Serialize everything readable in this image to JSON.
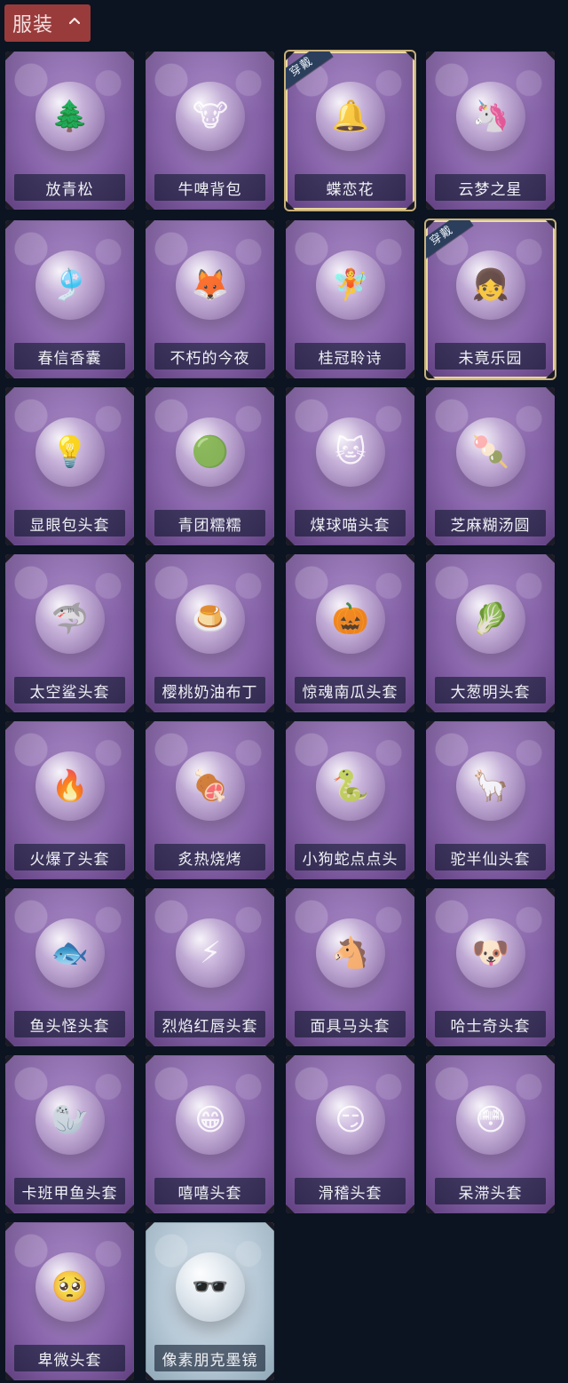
{
  "header": {
    "title": "服装",
    "chevron_icon": "chevron-up-icon"
  },
  "badges": {
    "wearing": "穿戴"
  },
  "items": [
    {
      "label": "放青松",
      "icon": "tree-icon",
      "selected": false,
      "theme": "purple"
    },
    {
      "label": "牛啤背包",
      "icon": "barrel-cow-icon",
      "selected": false,
      "theme": "purple"
    },
    {
      "label": "蝶恋花",
      "icon": "bell-ring-icon",
      "selected": true,
      "theme": "purple"
    },
    {
      "label": "云梦之星",
      "icon": "unicorn-icon",
      "selected": false,
      "theme": "purple"
    },
    {
      "label": "春信香囊",
      "icon": "sachet-icon",
      "selected": false,
      "theme": "purple"
    },
    {
      "label": "不朽的今夜",
      "icon": "fox-cup-icon",
      "selected": false,
      "theme": "purple"
    },
    {
      "label": "桂冠聆诗",
      "icon": "pendant-figure-icon",
      "selected": false,
      "theme": "purple"
    },
    {
      "label": "未竟乐园",
      "icon": "girl-icon",
      "selected": true,
      "theme": "purple"
    },
    {
      "label": "显眼包头套",
      "icon": "lightbulb-head-icon",
      "selected": false,
      "theme": "purple"
    },
    {
      "label": "青团糯糯",
      "icon": "green-bun-icon",
      "selected": false,
      "theme": "purple"
    },
    {
      "label": "煤球喵头套",
      "icon": "cat-head-icon",
      "selected": false,
      "theme": "purple"
    },
    {
      "label": "芝麻糊汤圆",
      "icon": "dumpling-icon",
      "selected": false,
      "theme": "purple"
    },
    {
      "label": "太空鲨头套",
      "icon": "shark-head-icon",
      "selected": false,
      "theme": "purple"
    },
    {
      "label": "樱桃奶油布丁",
      "icon": "pudding-icon",
      "selected": false,
      "theme": "purple"
    },
    {
      "label": "惊魂南瓜头套",
      "icon": "pumpkin-icon",
      "selected": false,
      "theme": "purple"
    },
    {
      "label": "大葱明头套",
      "icon": "scallion-icon",
      "selected": false,
      "theme": "purple"
    },
    {
      "label": "火爆了头套",
      "icon": "fire-head-icon",
      "selected": false,
      "theme": "purple"
    },
    {
      "label": "炙热烧烤",
      "icon": "bbq-head-icon",
      "selected": false,
      "theme": "purple"
    },
    {
      "label": "小狗蛇点点头",
      "icon": "snake-dog-icon",
      "selected": false,
      "theme": "purple"
    },
    {
      "label": "驼半仙头套",
      "icon": "alpaca-sunglasses-icon",
      "selected": false,
      "theme": "purple"
    },
    {
      "label": "鱼头怪头套",
      "icon": "fish-head-icon",
      "selected": false,
      "theme": "purple"
    },
    {
      "label": "烈焰红唇头套",
      "icon": "pikachu-sunglasses-icon",
      "selected": false,
      "theme": "purple"
    },
    {
      "label": "面具马头套",
      "icon": "horse-head-icon",
      "selected": false,
      "theme": "purple"
    },
    {
      "label": "哈士奇头套",
      "icon": "dog-sunglasses-icon",
      "selected": false,
      "theme": "purple"
    },
    {
      "label": "卡班甲鱼头套",
      "icon": "seal-head-icon",
      "selected": false,
      "theme": "purple"
    },
    {
      "label": "嘻嘻头套",
      "icon": "grin-emoji-icon",
      "selected": false,
      "theme": "purple"
    },
    {
      "label": "滑稽头套",
      "icon": "smirk-emoji-icon",
      "selected": false,
      "theme": "purple"
    },
    {
      "label": "呆滞头套",
      "icon": "stunned-emoji-icon",
      "selected": false,
      "theme": "purple"
    },
    {
      "label": "卑微头套",
      "icon": "sad-emoji-icon",
      "selected": false,
      "theme": "purple"
    },
    {
      "label": "像素朋克墨镜",
      "icon": "pixel-sunglasses-icon",
      "selected": false,
      "theme": "pale"
    }
  ]
}
